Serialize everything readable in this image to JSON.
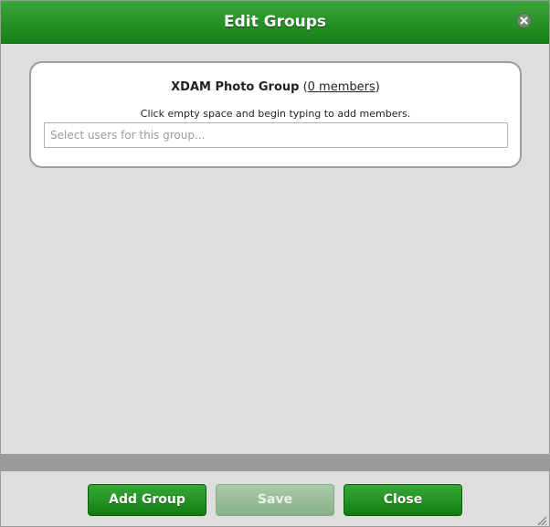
{
  "dialog": {
    "title": "Edit Groups",
    "close_icon": "close-circle-icon"
  },
  "group": {
    "name": "XDAM Photo Group",
    "paren_open": " (",
    "members_link": "0 members",
    "paren_close": ")",
    "instructions": "Click empty space and begin typing to add members.",
    "input_placeholder": "Select users for this group...",
    "input_value": ""
  },
  "footer": {
    "add_group_label": "Add Group",
    "save_label": "Save",
    "close_label": "Close"
  },
  "colors": {
    "titlebar": "#2a932a",
    "button_green": "#259325",
    "button_disabled": "#98bd98",
    "background": "#dedede"
  }
}
